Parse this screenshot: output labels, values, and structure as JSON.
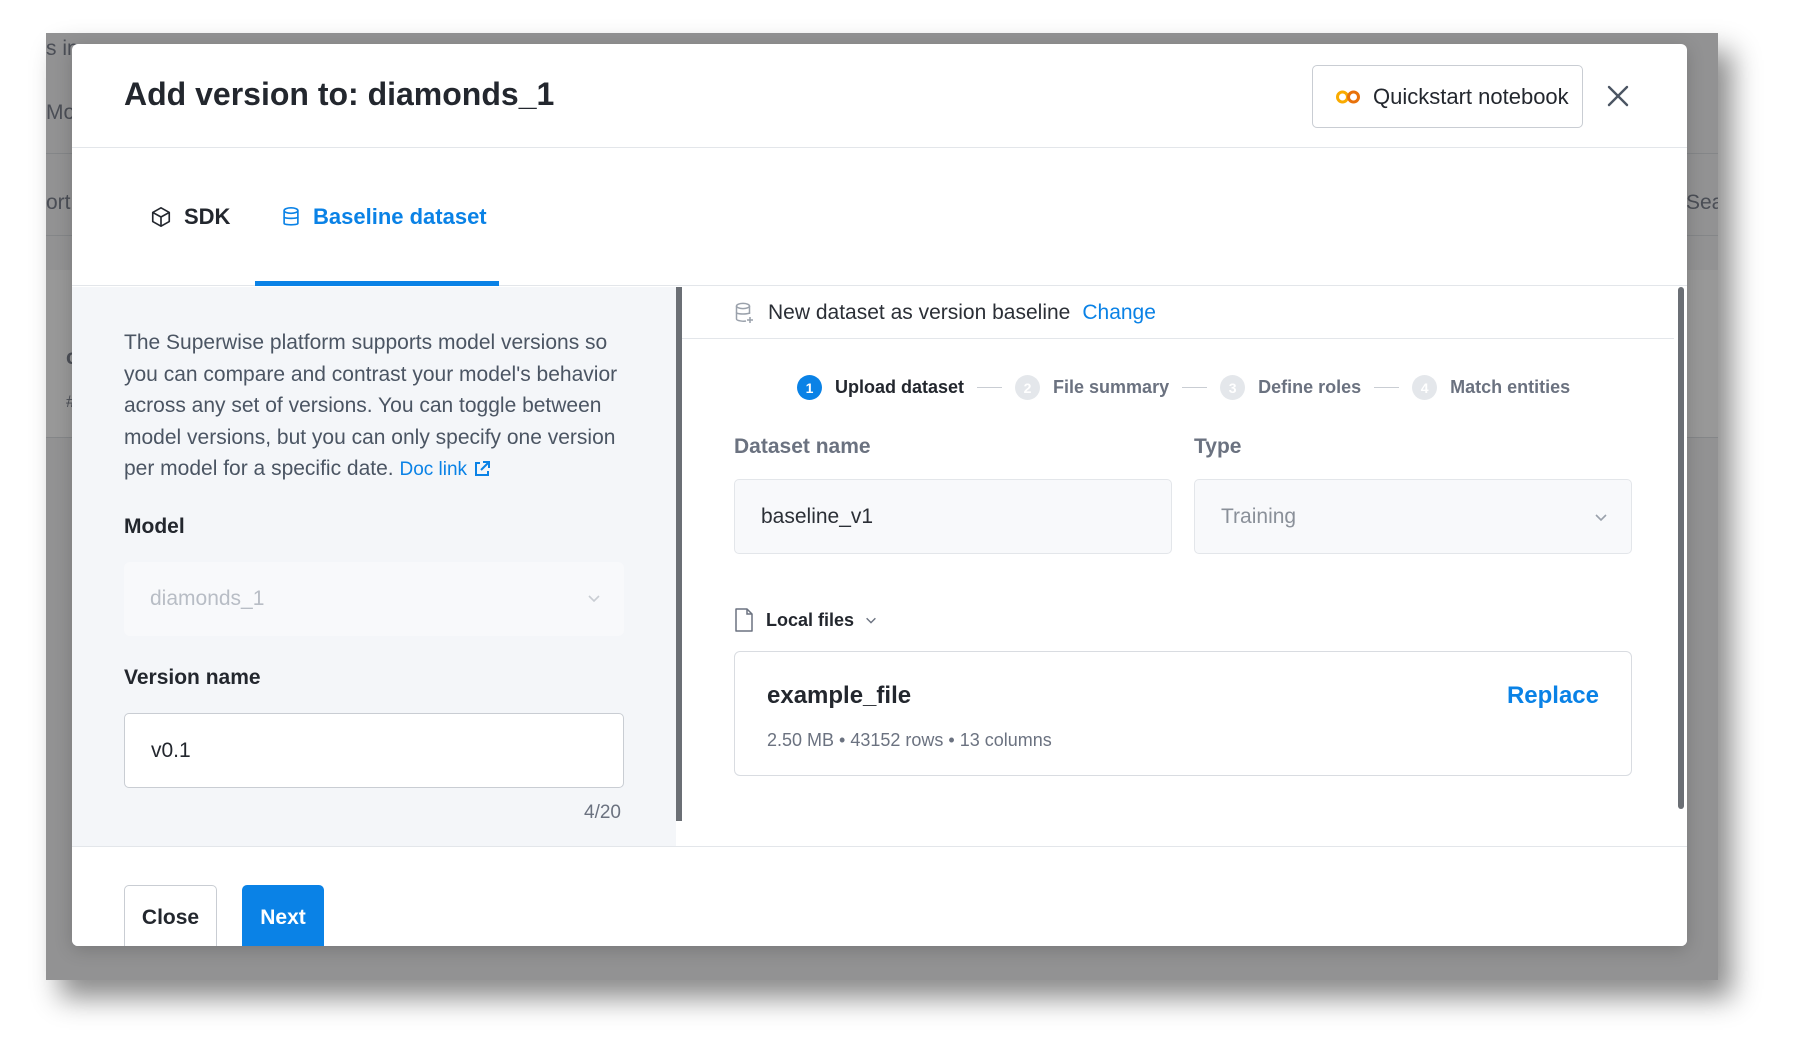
{
  "background": {
    "fragments": [
      "s in",
      "Mo",
      "ort",
      "Sear",
      "c",
      "#"
    ]
  },
  "modal": {
    "title": "Add version to: diamonds_1",
    "quickstart_label": "Quickstart notebook",
    "close_icon": "close-icon",
    "tabs": [
      {
        "label": "SDK",
        "icon": "cube-icon",
        "active": false
      },
      {
        "label": "Baseline dataset",
        "icon": "database-icon",
        "active": true
      }
    ]
  },
  "left": {
    "description": "The Superwise platform supports model versions so you can compare and contrast your model's behavior across any set of versions. You can toggle between model versions, but you can only specify one version per model for a specific date.",
    "doc_link_label": "Doc link",
    "model_label": "Model",
    "model_value": "diamonds_1",
    "version_label": "Version name",
    "version_value": "v0.1",
    "version_counter": "4/20"
  },
  "right": {
    "dataset_header": "New dataset as version baseline",
    "change_label": "Change",
    "steps": [
      {
        "num": "1",
        "label": "Upload dataset",
        "active": true
      },
      {
        "num": "2",
        "label": "File summary",
        "active": false
      },
      {
        "num": "3",
        "label": "Define roles",
        "active": false
      },
      {
        "num": "4",
        "label": "Match entities",
        "active": false
      }
    ],
    "dataset_name_label": "Dataset name",
    "dataset_name_value": "baseline_v1",
    "type_label": "Type",
    "type_value": "Training",
    "source_label": "Local files",
    "file": {
      "name": "example_file",
      "meta": "2.50 MB • 43152 rows • 13 columns",
      "replace_label": "Replace"
    }
  },
  "footer": {
    "close_label": "Close",
    "next_label": "Next"
  },
  "colors": {
    "accent": "#0a82e6",
    "colab_orange": "#f9ab00"
  }
}
